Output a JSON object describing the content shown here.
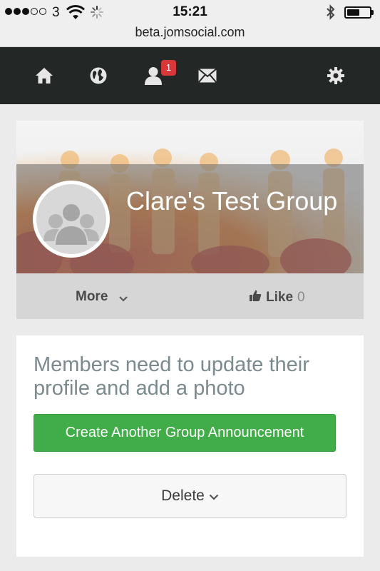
{
  "status_bar": {
    "carrier": "3",
    "time": "15:21",
    "battery_level": 0.55,
    "icons": [
      "signal-dots",
      "wifi-icon",
      "loading-spinner-icon",
      "bluetooth-icon",
      "battery-icon"
    ]
  },
  "browser": {
    "url": "beta.jomsocial.com"
  },
  "nav": {
    "items": [
      "home-icon",
      "globe-icon",
      "user-icon",
      "mail-icon",
      "gear-icon"
    ],
    "notification_count": "1",
    "badge_color": "#d9383a"
  },
  "group": {
    "name": "Clare's Test Group",
    "more_label": "More",
    "like_label": "Like",
    "like_count": "0"
  },
  "announcement": {
    "text": "Members need to update their profile and add a photo",
    "create_button": "Create Another Group Announcement",
    "delete_button": "Delete"
  },
  "colors": {
    "navbar": "#232725",
    "create_button": "#41ad49",
    "announcement_text": "#7b8a8e"
  }
}
